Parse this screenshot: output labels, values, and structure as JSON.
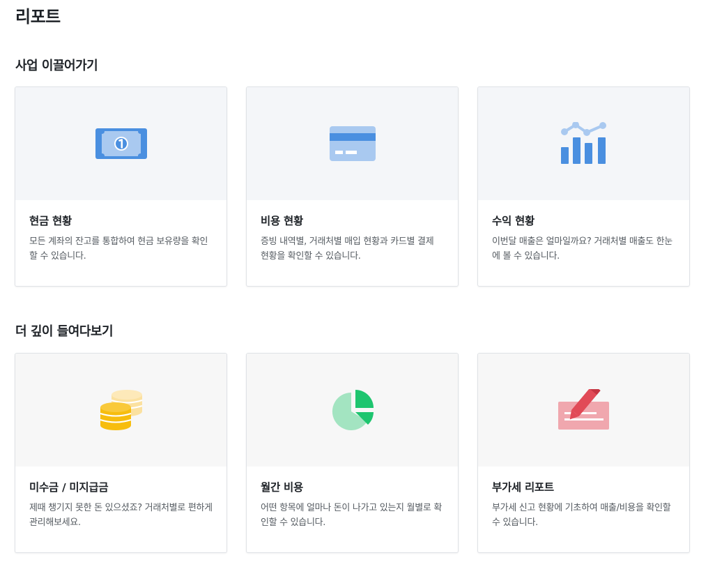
{
  "page": {
    "title": "리포트"
  },
  "sections": [
    {
      "title": "사업 이끌어가기",
      "cards": [
        {
          "icon": "banknote-icon",
          "title": "현금 현황",
          "description": "모든 계좌의 잔고를 통합하여 현금 보유량을 확인할 수 있습니다."
        },
        {
          "icon": "credit-card-icon",
          "title": "비용 현황",
          "description": "증빙 내역별, 거래처별 매입 현황과 카드별 결제 현황을 확인할 수 있습니다."
        },
        {
          "icon": "bar-line-chart-icon",
          "title": "수익 현황",
          "description": "이번달 매출은 얼마일까요? 거래처별 매출도 한눈에 볼 수 있습니다."
        }
      ]
    },
    {
      "title": "더 깊이 들여다보기",
      "cards": [
        {
          "icon": "coins-icon",
          "title": "미수금 / 미지급금",
          "description": "제때 챙기지 못한 돈 있으셨죠? 거래처별로 편하게 관리해보세요."
        },
        {
          "icon": "pie-chart-icon",
          "title": "월간 비용",
          "description": "어떤 항목에 얼마나 돈이 나가고 있는지 월별로 확인할 수 있습니다."
        },
        {
          "icon": "pencil-form-icon",
          "title": "부가세 리포트",
          "description": "부가세 신고 현황에 기초하여 매출/비용을 확인할 수 있습니다."
        }
      ]
    }
  ],
  "colors": {
    "blue": "#4a8fe0",
    "light_blue": "#a9c9f0",
    "yellow": "#f7bd0e",
    "light_yellow": "#fbe1a0",
    "green": "#1ec56f",
    "light_green": "#a3e4c1",
    "red": "#e14a57",
    "pink": "#f0a7ae"
  }
}
